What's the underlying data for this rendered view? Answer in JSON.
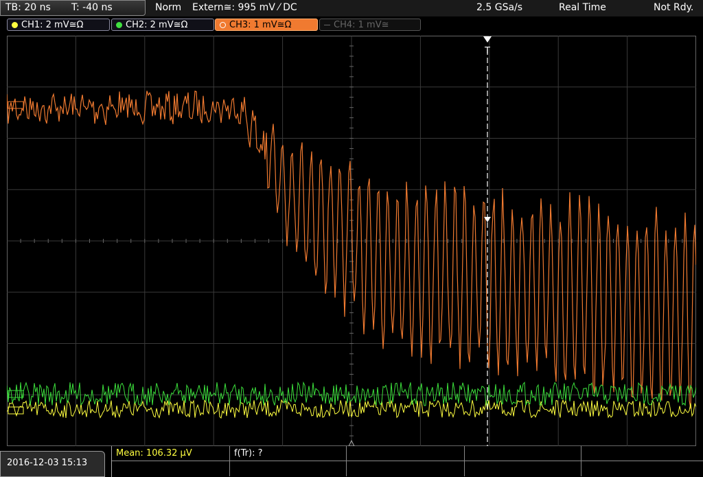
{
  "header": {
    "timebase": "TB: 20 ns",
    "trigger_time": "T: -40 ns",
    "trigger_mode": "Norm",
    "trigger_source": "Extern≅: 995 mV ⁄ DC",
    "sample_rate": "2.5 GSa/s",
    "acq_mode": "Real Time",
    "status": "Not Rdy."
  },
  "channels": [
    {
      "label": "CH1: 2 mV≅Ω",
      "color": "#ffff40",
      "state": "on"
    },
    {
      "label": "CH2: 2 mV≅Ω",
      "color": "#40e040",
      "state": "on"
    },
    {
      "label": "CH3: 1 mV≅Ω",
      "color": "#f07a30",
      "state": "active"
    },
    {
      "label": "CH4: 1 mV≅",
      "color": "#555555",
      "state": "off"
    }
  ],
  "trigger_marker": "T",
  "footer": {
    "date": "2016-12-03 15:13",
    "measurement_1": "Mean: 106.32 µV",
    "measurement_2": "f(Tr): ?"
  },
  "colors": {
    "ch1": "#ffff40",
    "ch2": "#3ce03c",
    "ch3": "#f07a30",
    "grid": "#3a3a3a",
    "background": "#000000"
  }
}
